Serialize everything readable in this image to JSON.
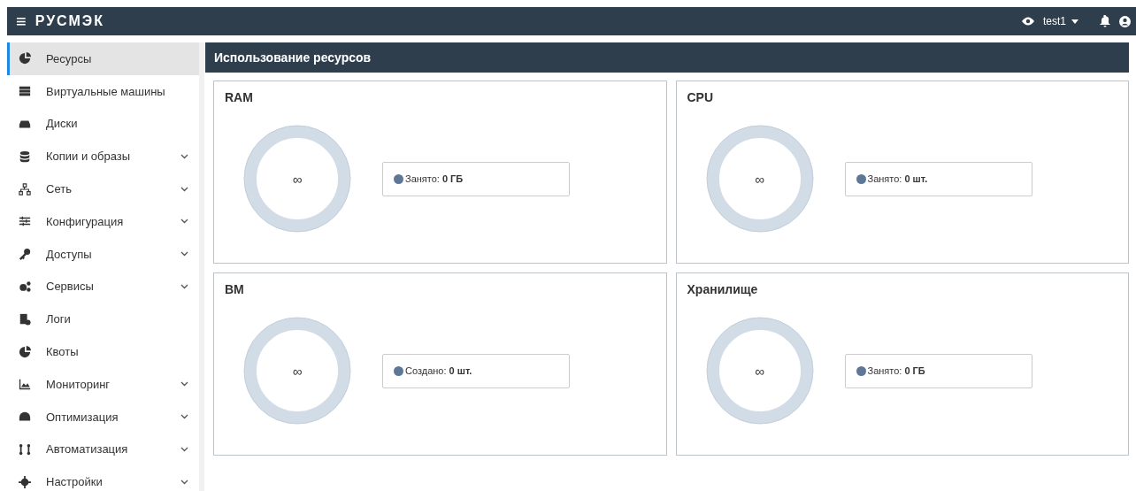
{
  "topbar": {
    "menu_glyph": "≡",
    "brand": "РУСМЭК",
    "user": "test1"
  },
  "sidebar": {
    "items": [
      {
        "label": "Ресурсы",
        "selected": true,
        "expandable": false
      },
      {
        "label": "Виртуальные машины",
        "selected": false,
        "expandable": false
      },
      {
        "label": "Диски",
        "selected": false,
        "expandable": false
      },
      {
        "label": "Копии и образы",
        "selected": false,
        "expandable": true
      },
      {
        "label": "Сеть",
        "selected": false,
        "expandable": true
      },
      {
        "label": "Конфигурация",
        "selected": false,
        "expandable": true
      },
      {
        "label": "Доступы",
        "selected": false,
        "expandable": true
      },
      {
        "label": "Сервисы",
        "selected": false,
        "expandable": true
      },
      {
        "label": "Логи",
        "selected": false,
        "expandable": false
      },
      {
        "label": "Квоты",
        "selected": false,
        "expandable": false
      },
      {
        "label": "Мониторинг",
        "selected": false,
        "expandable": true
      },
      {
        "label": "Оптимизация",
        "selected": false,
        "expandable": true
      },
      {
        "label": "Автоматизация",
        "selected": false,
        "expandable": true
      },
      {
        "label": "Настройки",
        "selected": false,
        "expandable": true
      }
    ]
  },
  "main": {
    "title": "Использование ресурсов",
    "cards": [
      {
        "title": "RAM",
        "center": "∞",
        "legend": "Занято: **0 ГБ**",
        "color": "#5f7796"
      },
      {
        "title": "CPU",
        "center": "∞",
        "legend": "Занято: **0 шт.**",
        "color": "#5f7796"
      },
      {
        "title": "ВМ",
        "center": "∞",
        "legend": "Создано: **0 шт.**",
        "color": "#5f7796"
      },
      {
        "title": "Хранилище",
        "center": "∞",
        "legend": "Занято: **0 ГБ**",
        "color": "#5f7796"
      }
    ]
  }
}
